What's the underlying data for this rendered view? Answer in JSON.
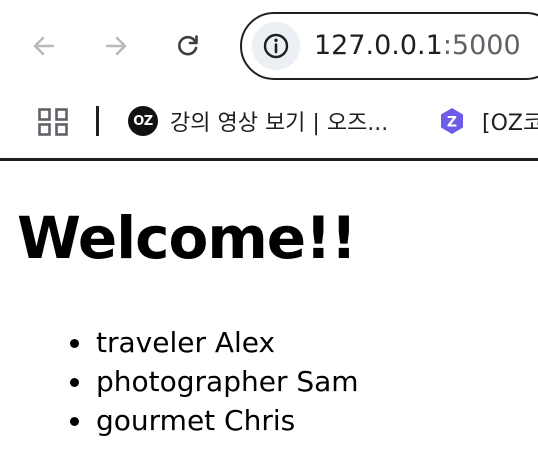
{
  "browser": {
    "url_host": "127.0.0.1",
    "url_port": ":5000",
    "bookmarks": [
      {
        "badge": "OZ",
        "label": "강의 영상 보기 | 오즈..."
      },
      {
        "badge": "Z",
        "label": "[OZ코"
      }
    ]
  },
  "page": {
    "heading": "Welcome!!",
    "items": [
      "traveler Alex",
      "photographer Sam",
      "gourmet Chris"
    ]
  },
  "icons": {
    "back": "arrow-left-icon",
    "forward": "arrow-right-icon",
    "reload": "reload-icon",
    "site_info": "info-icon",
    "apps": "apps-grid-icon",
    "bookmark_2": "z-badge-icon"
  },
  "colors": {
    "z_badge": "#6c5ce7"
  }
}
